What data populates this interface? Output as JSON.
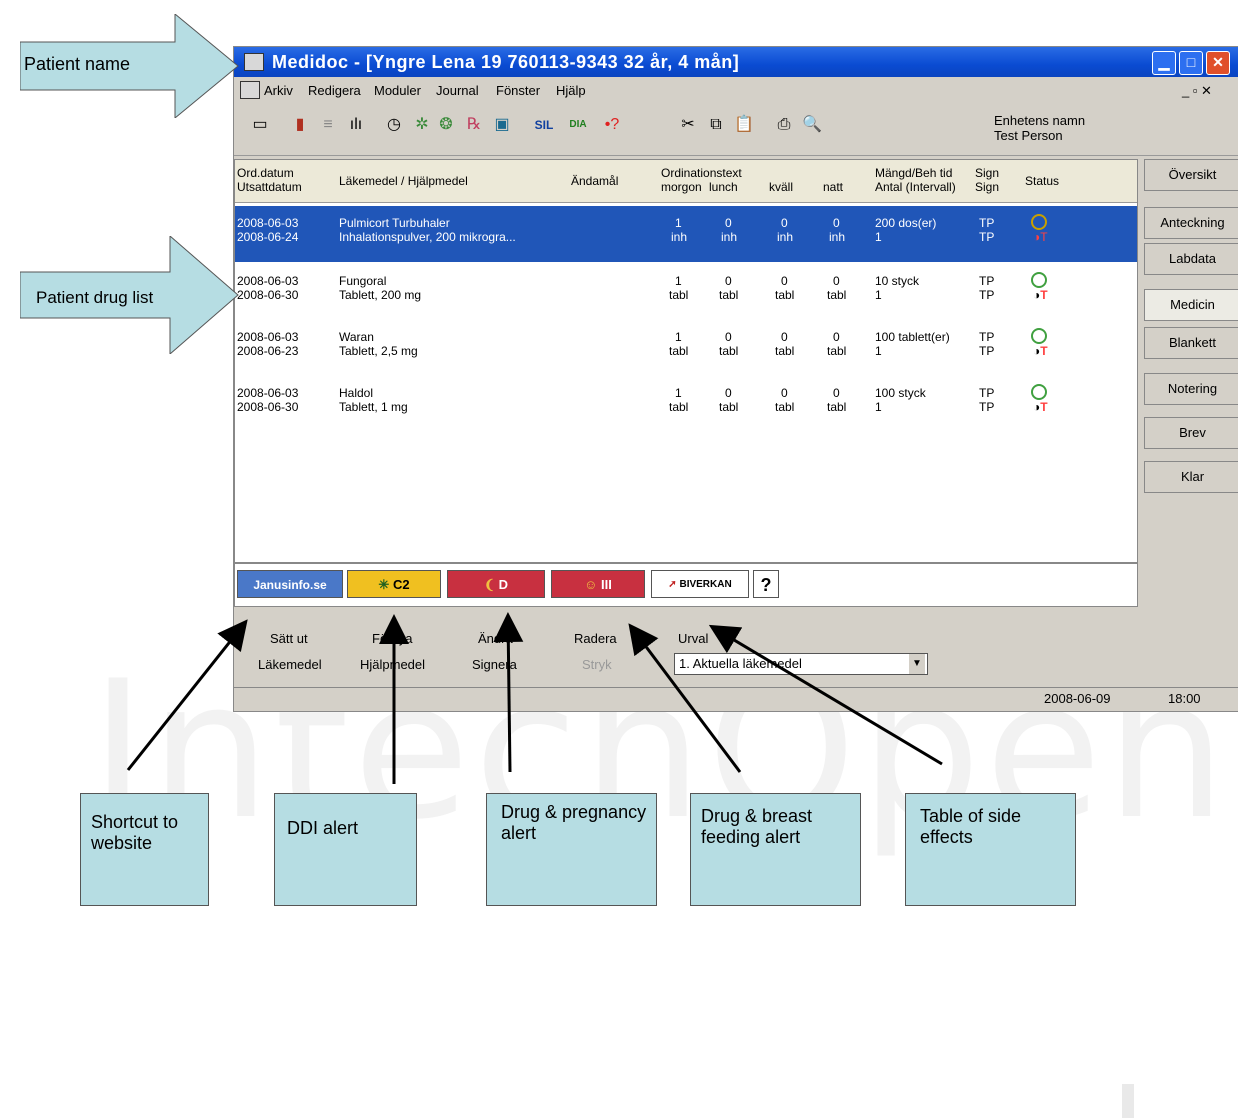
{
  "window": {
    "title": "Medidoc - [Yngre Lena   19 760113-9343     32 år, 4 mån]"
  },
  "menu": [
    "Arkiv",
    "Redigera",
    "Moduler",
    "Journal",
    "Fönster",
    "Hjälp"
  ],
  "unit": {
    "line1": "Enhetens namn",
    "line2": "Test Person"
  },
  "headers": {
    "ord1": "Ord.datum",
    "ord2": "Utsattdatum",
    "lakemedel": "Läkemedel / Hjälpmedel",
    "andamal": "Ändamål",
    "ordtext": "Ordinationstext",
    "morgon": "morgon",
    "lunch": "lunch",
    "kvall": "kväll",
    "natt": "natt",
    "mangd1": "Mängd/Beh tid",
    "mangd2": "Antal (Intervall)",
    "sign1": "Sign",
    "sign2": "Sign",
    "status": "Status"
  },
  "rows": [
    {
      "d1": "2008-06-03",
      "d2": "2008-06-24",
      "drug": "Pulmicort Turbuhaler",
      "form": "Inhalationspulver, 200 mikrogra...",
      "m": "1",
      "l": "0",
      "k": "0",
      "n": "0",
      "unit": "inh",
      "amt": "200 dos(er)",
      "cnt": "1",
      "s1": "TP",
      "s2": "TP"
    },
    {
      "d1": "2008-06-03",
      "d2": "2008-06-30",
      "drug": "Fungoral",
      "form": "Tablett, 200 mg",
      "m": "1",
      "l": "0",
      "k": "0",
      "n": "0",
      "unit": "tabl",
      "amt": "10 styck",
      "cnt": "1",
      "s1": "TP",
      "s2": "TP"
    },
    {
      "d1": "2008-06-03",
      "d2": "2008-06-23",
      "drug": "Waran",
      "form": "Tablett, 2,5 mg",
      "m": "1",
      "l": "0",
      "k": "0",
      "n": "0",
      "unit": "tabl",
      "amt": "100 tablett(er)",
      "cnt": "1",
      "s1": "TP",
      "s2": "TP"
    },
    {
      "d1": "2008-06-03",
      "d2": "2008-06-30",
      "drug": "Haldol",
      "form": "Tablett, 1 mg",
      "m": "1",
      "l": "0",
      "k": "0",
      "n": "0",
      "unit": "tabl",
      "amt": "100 styck",
      "cnt": "1",
      "s1": "TP",
      "s2": "TP"
    }
  ],
  "chips": {
    "janus": "Janusinfo.se",
    "c2": "C2",
    "d": "D",
    "iii": "III",
    "biverkan": "BIVERKAN",
    "q": "?"
  },
  "buttons": {
    "sattut": "Sätt ut",
    "fornya": "Förnya",
    "andra": "Ändra",
    "radera": "Radera",
    "urval": "Urval",
    "lakemedel": "Läkemedel",
    "hjalpmedel": "Hjälpmedel",
    "signera": "Signera",
    "stryk": "Stryk"
  },
  "combo_value": "1. Aktuella läkemedel",
  "sidetabs": [
    "Översikt",
    "Anteckning",
    "Labdata",
    "Medicin",
    "Blankett",
    "Notering",
    "Brev",
    "Klar"
  ],
  "status": {
    "date": "2008-06-09",
    "time": "18:00"
  },
  "callouts": {
    "patient_name": "Patient name",
    "drug_list": "Patient drug list",
    "shortcut": "Shortcut to website",
    "ddi": "DDI alert",
    "pregnancy": "Drug & pregnancy alert",
    "breast": "Drug & breast feeding alert",
    "side_effects": "Table of side effects"
  },
  "watermark": "IntechOpen"
}
